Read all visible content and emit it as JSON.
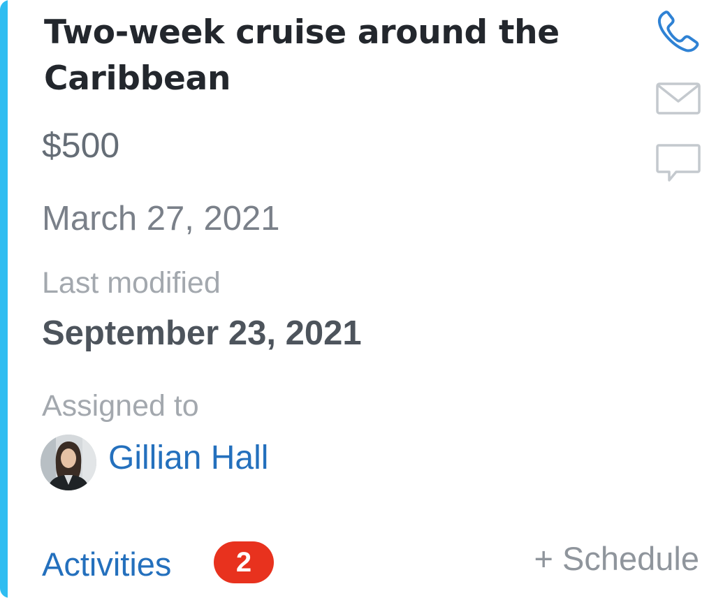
{
  "card": {
    "accent_color": "#2fbdf1",
    "title": "Two-week cruise around the Caribbean",
    "amount": "$500",
    "date": "March 27, 2021",
    "last_modified_label": "Last modified",
    "last_modified_date": "September 23, 2021",
    "assigned_label": "Assigned to",
    "assignee_name": "Gillian Hall",
    "activities_label": "Activities",
    "activities_count": "2",
    "schedule_label": "+ Schedule"
  },
  "actions": {
    "phone_icon": "phone-icon",
    "mail_icon": "mail-icon",
    "chat_icon": "chat-bubble-icon"
  },
  "colors": {
    "link": "#2470bd",
    "badge": "#e8321e",
    "phone_icon": "#2f82d4",
    "muted_icon": "#c4c9ce"
  }
}
